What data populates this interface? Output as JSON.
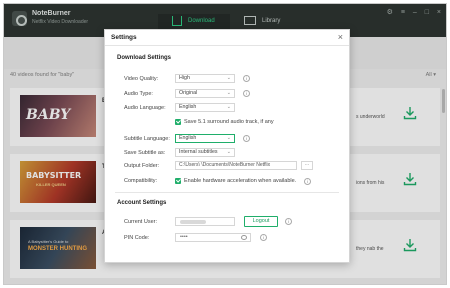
{
  "app": {
    "name": "NoteBurner",
    "subtitle": "Netflix Video Downloader",
    "tabs": [
      {
        "label": "Download",
        "icon": "download-tray-icon",
        "active": true
      },
      {
        "label": "Library",
        "icon": "monitor-icon",
        "active": false
      }
    ],
    "window_controls": [
      "⚙",
      "≡",
      "–",
      "□",
      "×"
    ]
  },
  "results": {
    "count_text": "40 videos found for \"baby\"",
    "filter_label": "All ▾",
    "rows": [
      {
        "thumb_text": "BABY",
        "title_initial": "B",
        "snippet": "s underworld"
      },
      {
        "thumb_text": "BABYSITTER",
        "thumb_sub": "KILLER QUEEN",
        "title_initial": "T",
        "snippet": "ions from his"
      },
      {
        "thumb_text": "MONSTER HUNTING",
        "thumb_sub": "A Babysitter's Guide to",
        "title_initial": "A",
        "snippet": "they nab the"
      }
    ]
  },
  "settings": {
    "title": "Settings",
    "close_icon": "×",
    "download_section": "Download Settings",
    "fields": {
      "video_quality": {
        "label": "Video Quality:",
        "value": "High"
      },
      "audio_type": {
        "label": "Audio Type:",
        "value": "Original"
      },
      "audio_language": {
        "label": "Audio Language:",
        "value": "English"
      },
      "surround": {
        "label": "Save 5.1 surround audio track, if any",
        "checked": true
      },
      "subtitle_language": {
        "label": "Subtitle Language:",
        "value": "English"
      },
      "save_subtitle_as": {
        "label": "Save Subtitle as:",
        "value": "Internal subtitles"
      },
      "output_folder": {
        "label": "Output Folder:",
        "value": "C:\\Users\\        \\Documents\\NoteBurner Netflix",
        "browse": "···"
      },
      "compatibility": {
        "label": "Compatibility:",
        "option": "Enable hardware acceleration when available.",
        "checked": true
      }
    },
    "account_section": "Account Settings",
    "account": {
      "user_label": "Current User:",
      "logout_button": "Logout",
      "pin_label": "PIN Code:",
      "pin_value": "••••"
    },
    "info_glyph": "i"
  },
  "colors": {
    "accent": "#1fae6a",
    "header_bg": "#2e3532",
    "active_tab": "#2fd088"
  }
}
